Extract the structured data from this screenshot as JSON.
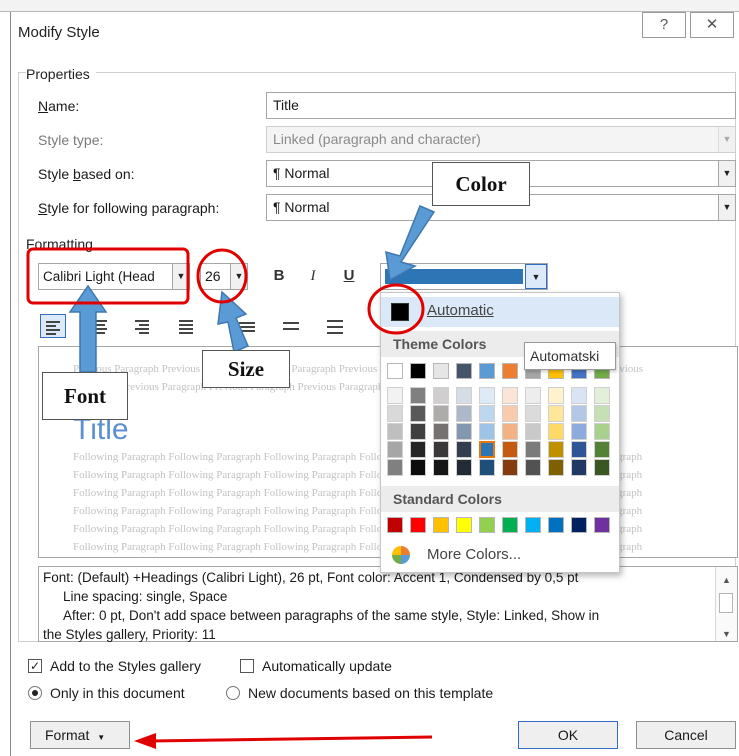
{
  "window": {
    "title": "Modify Style",
    "help_label": "?",
    "close_label": "✕"
  },
  "properties": {
    "section_label": "Properties",
    "name_label": "Name:",
    "name_value": "Title",
    "style_type_label": "Style type:",
    "style_type_value": "Linked (paragraph and character)",
    "based_on_label": "Style based on:",
    "based_on_value": "¶  Normal",
    "following_label": "Style for following paragraph:",
    "following_value": "¶  Normal"
  },
  "formatting": {
    "section_label": "Formatting",
    "font_value": "Calibri Light (Head",
    "size_value": "26",
    "bold_label": "B",
    "italic_label": "I",
    "underline_label": "U",
    "font_color_hex": "#2e75b6"
  },
  "preview": {
    "previous_1": "Previous Paragraph Previous Paragraph Previous Paragraph Previous Paragraph Previous Paragraph Previous Paragraph Previous",
    "previous_2": "Paragraph Previous Paragraph Previous Paragraph Previous Paragraph Previous",
    "title_text": "Title",
    "following_1": "Following Paragraph Following Paragraph Following Paragraph Following Paragraph Following Paragraph Following Paragraph",
    "following_2": "Following Paragraph Following Paragraph Following Paragraph Following Paragraph Following Paragraph Following Paragraph",
    "following_3": "Following Paragraph Following Paragraph Following Paragraph Following Paragraph Following Paragraph Following Paragraph",
    "following_4": "Following Paragraph Following Paragraph Following Paragraph Following Paragraph Following Paragraph Following Paragraph",
    "following_5": "Following Paragraph Following Paragraph Following Paragraph Following Paragraph Following Paragraph Following Paragraph",
    "following_6": "Following Paragraph Following Paragraph Following Paragraph Following Paragraph Following Paragraph Following Paragraph"
  },
  "description": {
    "line1": "Font: (Default) +Headings (Calibri Light), 26 pt, Font color: Accent 1, Condensed by  0,5 pt",
    "line2": "Line spacing:  single, Space",
    "line3": "After:  0 pt, Don't add space between paragraphs of the same style, Style: Linked, Show in",
    "line4": "the Styles gallery, Priority: 11"
  },
  "options": {
    "add_to_gallery": "Add to the Styles gallery",
    "auto_update": "Automatically update",
    "only_this_doc": "Only in this document",
    "new_docs": "New documents based on this template"
  },
  "buttons": {
    "format": "Format",
    "ok": "OK",
    "cancel": "Cancel"
  },
  "color_popup": {
    "automatic": "Automatic",
    "theme_colors": "Theme Colors",
    "standard_colors": "Standard Colors",
    "more_colors": "More Colors...",
    "tooltip": "Automatski",
    "theme_top": [
      "#ffffff",
      "#000000",
      "#e7e6e6",
      "#44546a",
      "#5b9bd5",
      "#ed7d31",
      "#a5a5a5",
      "#ffc000",
      "#4472c4",
      "#70ad47"
    ],
    "theme_shades": [
      [
        "#f2f2f2",
        "#808080",
        "#d0cece",
        "#d6dce5",
        "#deebf7",
        "#fbe5d6",
        "#ededed",
        "#fff2cc",
        "#dae3f3",
        "#e2f0d9"
      ],
      [
        "#d9d9d9",
        "#595959",
        "#aeabab",
        "#adb9ca",
        "#bdd7ee",
        "#f8cbad",
        "#dbdbdb",
        "#ffe699",
        "#b4c7e7",
        "#c5e0b4"
      ],
      [
        "#bfbfbf",
        "#404040",
        "#757171",
        "#8497b0",
        "#9dc3e6",
        "#f4b183",
        "#c9c9c9",
        "#ffd966",
        "#8faadc",
        "#a9d18e"
      ],
      [
        "#a6a6a6",
        "#262626",
        "#3a3838",
        "#333f50",
        "#2e75b6",
        "#c55a11",
        "#7b7b7b",
        "#bf9000",
        "#2f5597",
        "#538135"
      ],
      [
        "#808080",
        "#0d0d0d",
        "#171616",
        "#222a35",
        "#1f4e79",
        "#843c0c",
        "#525252",
        "#7f6000",
        "#203864",
        "#385723"
      ]
    ],
    "standard": [
      "#c00000",
      "#ff0000",
      "#ffc000",
      "#ffff00",
      "#92d050",
      "#00b050",
      "#00b0f0",
      "#0070c0",
      "#002060",
      "#7030a0"
    ]
  },
  "annotations": {
    "color_label": "Color",
    "font_label": "Font",
    "size_label": "Size",
    "highlight_hex": "#e00000",
    "arrow_hex": "#5b9bd5"
  }
}
